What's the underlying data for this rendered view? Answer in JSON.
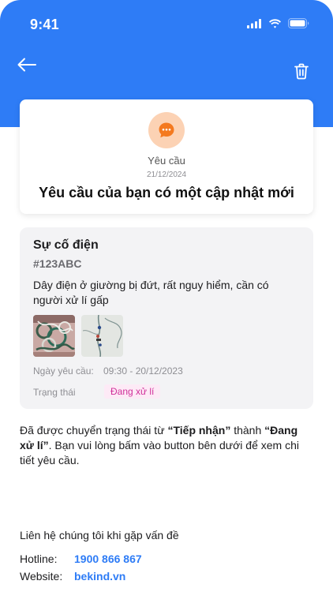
{
  "status_bar": {
    "time": "9:41"
  },
  "header": {
    "back_icon": "arrow-left-icon",
    "delete_icon": "trash-icon",
    "color": "#2e7cf6"
  },
  "notice": {
    "icon": "chat-bubble-icon",
    "type": "Yêu cầu",
    "date": "21/12/2024",
    "title": "Yêu cầu của bạn có một cập nhật mới"
  },
  "request": {
    "title": "Sự cố điện",
    "code": "#123ABC",
    "description": "Dây điện ở giường bị đứt, rất nguy hiểm, cần có người xử lí gấp",
    "date_label": "Ngày yêu cầu:",
    "date_value": "09:30 - 20/12/2023",
    "status_label": "Trạng thái",
    "status_value": "Đang xử lí",
    "status_color": "#d0309a"
  },
  "message": {
    "part1": "Đã được chuyển trạng thái từ ",
    "from": "“Tiếp nhận”",
    "part2": " thành ",
    "to": "“Đang xử lí”",
    "part3": ". Bạn vui lòng bấm vào button bên dưới để xem chi tiết yêu cầu."
  },
  "contact": {
    "title": "Liên hệ chúng tôi khi gặp vấn đề",
    "hotline_label": "Hotline:",
    "hotline_value": "1900 866 867",
    "website_label": "Website:",
    "website_value": "bekind.vn"
  }
}
